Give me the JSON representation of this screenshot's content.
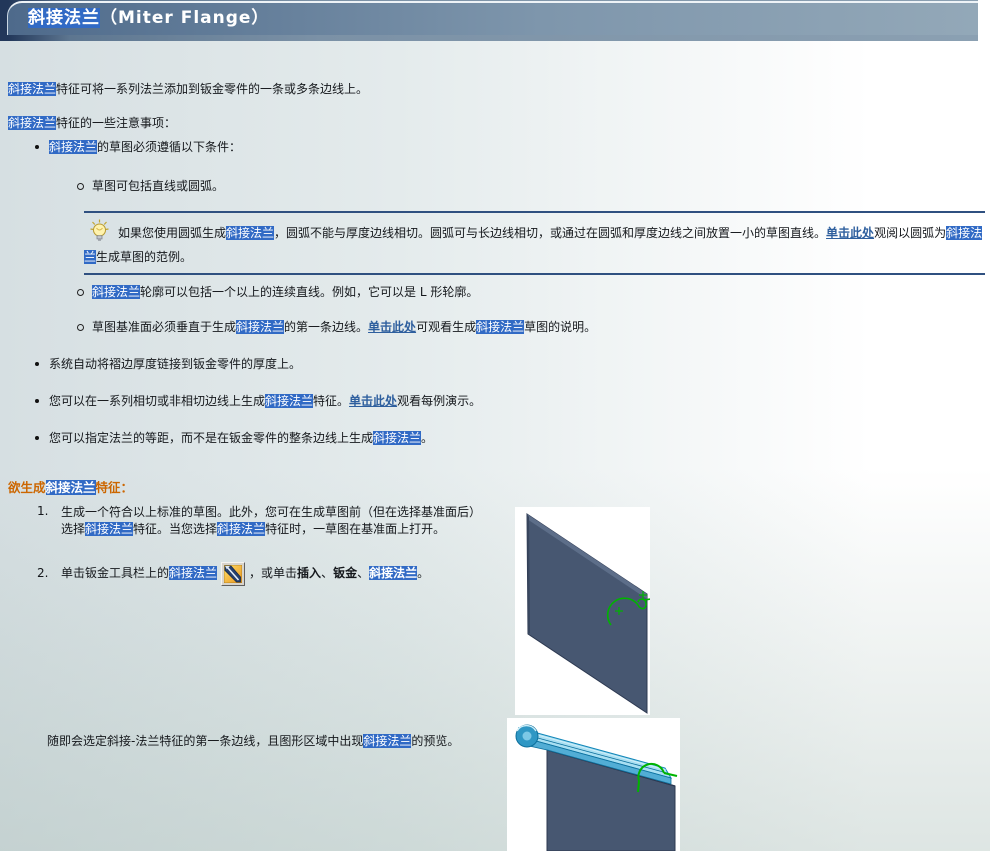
{
  "header": {
    "title_highlight": "斜接法兰",
    "title_rest": "（Miter Flange）"
  },
  "body": {
    "p1": [
      "斜接法兰",
      "特征可将一系列法兰添加到钣金零件的一条或多条边线上。"
    ],
    "p2": [
      "斜接法兰",
      "特征的一些注意事项："
    ],
    "bullet1": [
      "斜接法兰",
      "的草图必须遵循以下条件："
    ],
    "sub1": "草图可包括直线或圆弧。",
    "note": [
      "如果您使用圆弧生成",
      "斜接法兰",
      "，圆弧不能与厚度边线相切。圆弧可与长边线相切，或通过在圆弧和厚度边线之间放置一小的草图直线。",
      "单击此处",
      "观阅以圆弧为",
      "斜接法兰",
      "生成草图的范例。"
    ],
    "sub2": [
      "斜接法兰",
      "轮廓可以包括一个以上的连续直线。例如，它可以是 L 形轮廓。"
    ],
    "sub3": [
      "草图基准面必须垂直于生成",
      "斜接法兰",
      "的第一条边线。",
      "单击此处",
      "可观看生成",
      "斜接法兰",
      "草图的说明。"
    ],
    "bullet2": "系统自动将褶边厚度链接到钣金零件的厚度上。",
    "bullet3": [
      "您可以在一系列相切或非相切边线上生成",
      "斜接法兰",
      "特征。",
      "单击此处",
      "观看每例演示。"
    ],
    "bullet4": [
      "您可以指定法兰的等距，而不是在钣金零件的整条边线上生成",
      "斜接法兰",
      "。"
    ],
    "heading": [
      "欲生成",
      "斜接法兰",
      "特征："
    ],
    "step1": {
      "num": "1.",
      "segs": [
        "生成一个符合以上标准的草图。此外，您可在生成草图前（但在选择基准面后）选择",
        "斜接法兰",
        "特征。当您选择",
        "斜接法兰",
        "特征时，一草图在基准面上打开。"
      ]
    },
    "step2": {
      "num": "2.",
      "segs": [
        "单击钣金工具栏上的",
        "斜接法兰",
        "，或单击",
        "插入",
        "、",
        "钣金",
        "、",
        "斜接法兰",
        "。"
      ]
    },
    "result": [
      "随即会选定斜接-法兰特征的第一条边线，且图形区域中出现",
      "斜接法兰",
      "的预览。"
    ]
  },
  "icons": {
    "lightbulb": "tip-lightbulb-icon",
    "toolbar_button": "miter-flange-toolbar-icon"
  },
  "colors": {
    "search_highlight": "#316ac5",
    "link": "#2e5f9e",
    "heading": "#cc6600",
    "header_bar_left": "#4e6a8b",
    "header_bar_right": "#93a8b8"
  }
}
